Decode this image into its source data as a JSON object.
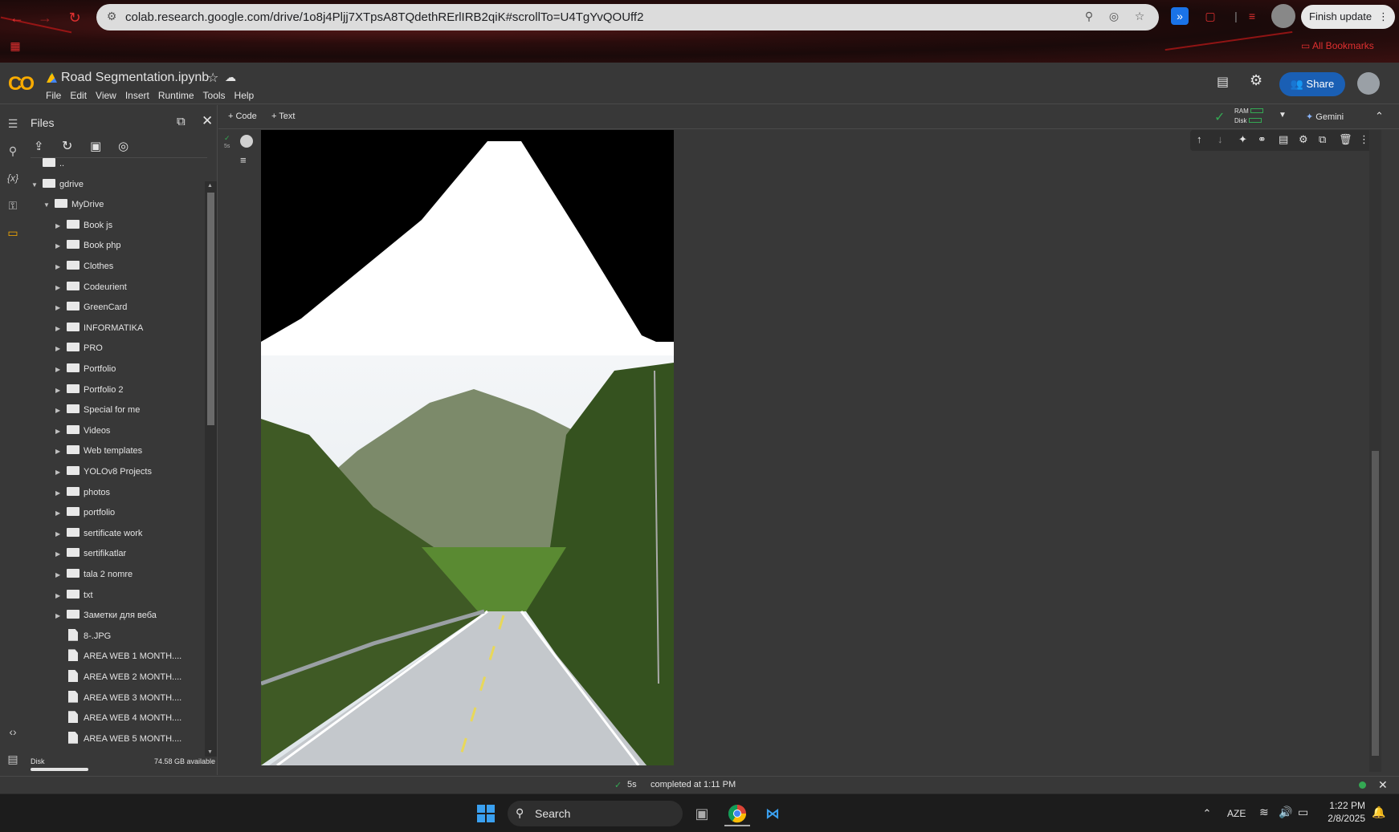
{
  "browser": {
    "url": "colab.research.google.com/drive/1o8j4Pljj7XTpsA8TQdethRErlIRB2qiK#scrollTo=U4TgYvQOUff2",
    "finish_update_label": "Finish update",
    "bookmarks_label": "All Bookmarks",
    "accent": "#e03030"
  },
  "colab": {
    "logo": "CO",
    "notebook_title": "Road Segmentation.ipynb",
    "menu": [
      "File",
      "Edit",
      "View",
      "Insert",
      "Runtime",
      "Tools",
      "Help"
    ],
    "share_label": "Share",
    "share_color": "#1a5fb4"
  },
  "files_panel": {
    "title": "Files",
    "items": [
      {
        "label": "..",
        "kind": "parent",
        "depth": 0
      },
      {
        "label": "gdrive",
        "kind": "folder",
        "depth": 0,
        "expanded": true
      },
      {
        "label": "MyDrive",
        "kind": "folder",
        "depth": 1,
        "expanded": true
      },
      {
        "label": "Book js",
        "kind": "folder",
        "depth": 2
      },
      {
        "label": "Book php",
        "kind": "folder",
        "depth": 2
      },
      {
        "label": "Clothes",
        "kind": "folder",
        "depth": 2
      },
      {
        "label": "Codeurient",
        "kind": "folder",
        "depth": 2
      },
      {
        "label": "GreenCard",
        "kind": "folder",
        "depth": 2
      },
      {
        "label": "INFORMATIKA",
        "kind": "folder",
        "depth": 2
      },
      {
        "label": "PRO",
        "kind": "folder",
        "depth": 2
      },
      {
        "label": "Portfolio",
        "kind": "folder",
        "depth": 2
      },
      {
        "label": "Portfolio 2",
        "kind": "folder",
        "depth": 2
      },
      {
        "label": "Special for me",
        "kind": "folder",
        "depth": 2
      },
      {
        "label": "Videos",
        "kind": "folder",
        "depth": 2
      },
      {
        "label": "Web templates",
        "kind": "folder",
        "depth": 2
      },
      {
        "label": "YOLOv8 Projects",
        "kind": "folder",
        "depth": 2
      },
      {
        "label": "photos",
        "kind": "folder",
        "depth": 2
      },
      {
        "label": "portfolio",
        "kind": "folder",
        "depth": 2
      },
      {
        "label": "sertificate work",
        "kind": "folder",
        "depth": 2
      },
      {
        "label": "sertifikatlar",
        "kind": "folder",
        "depth": 2
      },
      {
        "label": "tala 2 nomre",
        "kind": "folder",
        "depth": 2
      },
      {
        "label": "txt",
        "kind": "folder",
        "depth": 2
      },
      {
        "label": "Заметки для веба",
        "kind": "folder",
        "depth": 2
      },
      {
        "label": "8-.JPG",
        "kind": "file",
        "depth": 2
      },
      {
        "label": "AREA WEB 1 MONTH....",
        "kind": "file",
        "depth": 2
      },
      {
        "label": "AREA WEB 2 MONTH....",
        "kind": "file",
        "depth": 2
      },
      {
        "label": "AREA WEB 3 MONTH....",
        "kind": "file",
        "depth": 2
      },
      {
        "label": "AREA WEB 4 MONTH....",
        "kind": "file",
        "depth": 2
      },
      {
        "label": "AREA WEB 5 MONTH....",
        "kind": "file",
        "depth": 2
      }
    ],
    "disk_label": "Disk",
    "disk_available": "74.58 GB available"
  },
  "toolbar": {
    "code_label": "+ Code",
    "text_label": "+ Text",
    "ram_label": "RAM",
    "disk_label": "Disk",
    "gemini_label": "Gemini"
  },
  "cell": {
    "exec_time": "5s"
  },
  "status": {
    "duration": "5s",
    "message": "completed at 1:11 PM",
    "ok_color": "#34a853"
  },
  "taskbar": {
    "search_label": "Search",
    "language": "AZE",
    "time": "1:22 PM",
    "date": "2/8/2025"
  }
}
